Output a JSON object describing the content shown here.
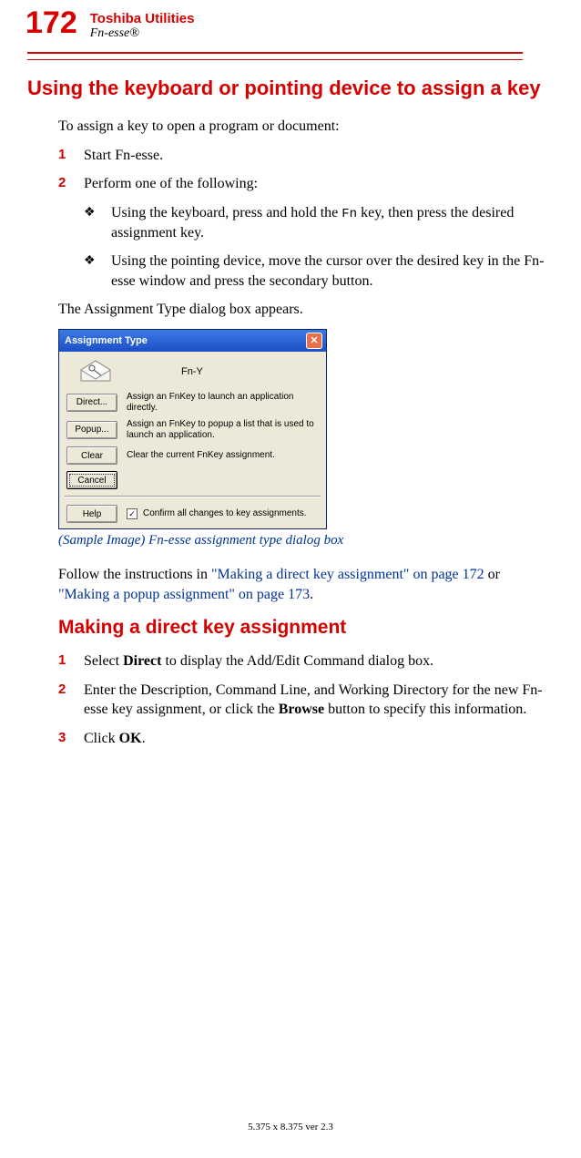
{
  "header": {
    "page_number": "172",
    "title": "Toshiba Utilities",
    "subtitle": "Fn-esse®"
  },
  "section": {
    "title": "Using the keyboard or pointing device to assign a key",
    "intro": "To assign a key to open a program or document:"
  },
  "steps_a": [
    "Start Fn-esse.",
    "Perform one of the following:"
  ],
  "bullets": [
    {
      "pre": "Using the keyboard, press and hold the ",
      "key": "Fn",
      "post": " key, then press the desired assignment key."
    },
    {
      "text": "Using the pointing device, move the cursor over the desired key in the Fn-esse window and press the secondary button."
    }
  ],
  "dialog_intro": "The Assignment Type dialog box appears.",
  "dialog": {
    "title": "Assignment Type",
    "fn_label": "Fn-Y",
    "buttons": {
      "direct": "Direct...",
      "popup": "Popup...",
      "clear": "Clear",
      "cancel": "Cancel",
      "help": "Help"
    },
    "descs": {
      "direct": "Assign an FnKey to launch an application directly.",
      "popup": "Assign an FnKey to popup a list that is used to launch an application.",
      "clear": "Clear the current FnKey assignment."
    },
    "confirm": "Confirm all changes to key assignments."
  },
  "caption": "(Sample Image) Fn-esse assignment type dialog box",
  "follow": {
    "pre": "Follow the instructions in ",
    "link1": "\"Making a direct key assignment\" on page 172",
    "mid": " or ",
    "link2": "\"Making a popup assignment\" on page 173",
    "post": "."
  },
  "subsection": {
    "title": "Making a direct key assignment"
  },
  "steps_b": [
    {
      "pre": "Select ",
      "bold1": "Direct",
      "post": " to display the Add/Edit Command dialog box."
    },
    {
      "pre": "Enter the Description, Command Line, and Working Directory for the new Fn-esse key assignment, or click the ",
      "bold1": "Browse",
      "post": " button to specify this information."
    },
    {
      "pre": "Click ",
      "bold1": "OK",
      "post": "."
    }
  ],
  "footer": "5.375 x 8.375 ver 2.3"
}
